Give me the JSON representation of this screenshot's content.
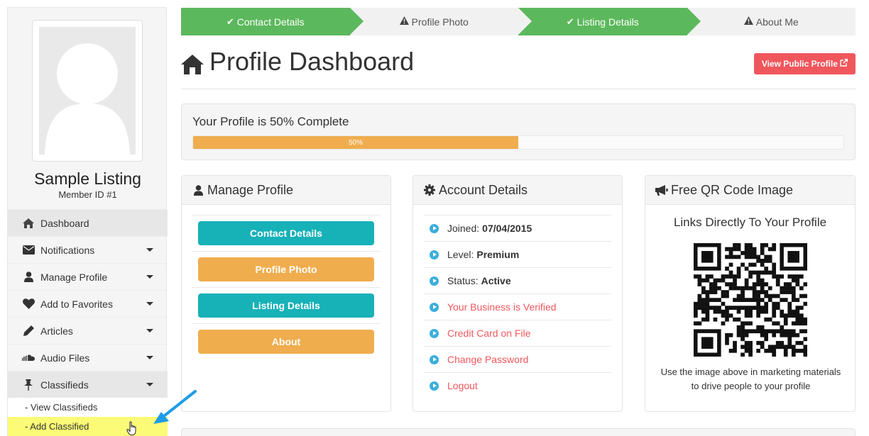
{
  "wizard": {
    "steps": [
      {
        "label": "Contact Details",
        "icon": "check-icon",
        "state": "done"
      },
      {
        "label": "Profile Photo",
        "icon": "warning-icon",
        "state": "todo"
      },
      {
        "label": "Listing Details",
        "icon": "check-icon",
        "state": "done"
      },
      {
        "label": "About Me",
        "icon": "warning-icon",
        "state": "todo"
      }
    ]
  },
  "profile": {
    "name": "Sample Listing",
    "member_id": "Member ID #1"
  },
  "sidebar": {
    "items": [
      {
        "label": "Dashboard",
        "icon": "home-icon"
      },
      {
        "label": "Notifications",
        "icon": "envelope-icon"
      },
      {
        "label": "Manage Profile",
        "icon": "user-icon"
      },
      {
        "label": "Add to Favorites",
        "icon": "heart-icon"
      },
      {
        "label": "Articles",
        "icon": "pencil-icon"
      },
      {
        "label": "Audio Files",
        "icon": "soundcloud-icon"
      },
      {
        "label": "Classifieds",
        "icon": "pushpin-icon"
      }
    ],
    "subitems": [
      {
        "label": "- View Classifieds"
      },
      {
        "label": "- Add Classified"
      }
    ]
  },
  "header": {
    "title": "Profile Dashboard",
    "public_button": "View Public Profile"
  },
  "progress": {
    "title": "Your Profile is 50% Complete",
    "label": "50%",
    "value": 0.5
  },
  "manage": {
    "title": "Manage Profile",
    "buttons": [
      "Contact Details",
      "Profile Photo",
      "Listing Details",
      "About"
    ]
  },
  "account": {
    "title": "Account Details",
    "joined_label": "Joined:",
    "joined_value": "07/04/2015",
    "level_label": "Level:",
    "level_value": "Premium",
    "status_label": "Status:",
    "status_value": "Active",
    "links": [
      "Your Business is Verified",
      "Credit Card on File",
      "Change Password",
      "Logout"
    ]
  },
  "qr": {
    "title": "Free QR Code Image",
    "subtitle": "Links Directly To Your Profile",
    "footer_line1": "Use the image above in marketing materials",
    "footer_line2": "to drive people to your profile"
  },
  "colors": {
    "success": "#5cb85c",
    "warning": "#f0ad4e",
    "teal": "#17b1b8",
    "danger": "#f0575d",
    "info": "#3aaedc",
    "highlight": "#fbfb77"
  }
}
